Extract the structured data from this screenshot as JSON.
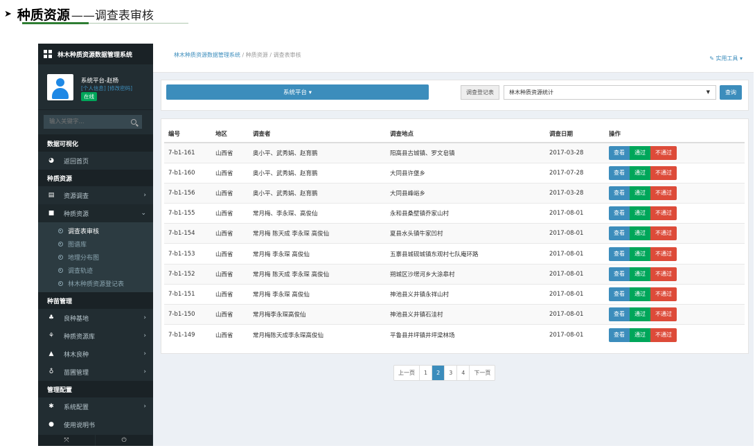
{
  "doc": {
    "title": "种质资源",
    "subtitle": "——调查表审核"
  },
  "app": {
    "system_name": "林木种质资源数据管理系统",
    "user": {
      "name": "系统平台-赵杨",
      "links": "[个人信息] [修改密码]",
      "status": "在线"
    },
    "search_placeholder": "输入关键字...",
    "sidebar": {
      "sections": [
        {
          "header": "数据可视化",
          "items": [
            {
              "label": "返回首页",
              "icon": "dashboard-icon",
              "glyph": "◕"
            }
          ]
        },
        {
          "header": "种质资源",
          "items": [
            {
              "label": "资源调查",
              "icon": "table-icon",
              "glyph": "▤",
              "chevron": "›"
            },
            {
              "label": "种质资源",
              "icon": "book-icon",
              "glyph": "■",
              "chevron": "⌄",
              "open": true
            }
          ]
        },
        {
          "header": "种苗管理",
          "items": [
            {
              "label": "良种基地",
              "icon": "tree-icon",
              "glyph": "♣",
              "chevron": "›"
            },
            {
              "label": "种质资源库",
              "icon": "leaf-icon",
              "glyph": "⚘",
              "chevron": "›"
            },
            {
              "label": "林木良种",
              "icon": "pine-icon",
              "glyph": "▲",
              "chevron": "›"
            },
            {
              "label": "苗圃管理",
              "icon": "seedling-icon",
              "glyph": "♁",
              "chevron": "›"
            }
          ]
        },
        {
          "header": "管理配置",
          "items": [
            {
              "label": "系统配置",
              "icon": "gear-icon",
              "glyph": "✱",
              "chevron": "›"
            },
            {
              "label": "使用说明书",
              "icon": "help-icon",
              "glyph": "●",
              "chevron": ""
            }
          ]
        }
      ],
      "submenu": [
        {
          "label": "调查表审核",
          "active": true
        },
        {
          "label": "图谱库"
        },
        {
          "label": "地理分布图"
        },
        {
          "label": "调查轨迹"
        },
        {
          "label": "林木种质资源登记表"
        }
      ],
      "footer": [
        {
          "icon": "expand-icon",
          "glyph": "⤧"
        },
        {
          "icon": "power-icon",
          "glyph": "⏻"
        }
      ]
    },
    "breadcrumb": [
      "林木种质资源数据管理系统",
      "种质资源",
      "调查表审核"
    ],
    "tools_label": "✎ 实用工具 ▾",
    "platform_button": "系统平台 ▾",
    "register_label": "调查登记表",
    "register_value": "林木种质资源统计",
    "query_button": "查询",
    "table": {
      "headers": [
        "编号",
        "地区",
        "调查者",
        "调查地点",
        "调查日期",
        "操作"
      ],
      "rows": [
        [
          "7-b1-161",
          "山西省",
          "奥小平、武秀娟、赵育鹏",
          "阳高县古城镇、罗文皂镇",
          "2017-03-28"
        ],
        [
          "7-b1-160",
          "山西省",
          "奥小平、武秀娟、赵育鹏",
          "大同县许堡乡",
          "2017-07-28"
        ],
        [
          "7-b1-156",
          "山西省",
          "奥小平、武秀娟、赵育鹏",
          "大同县峰峪乡",
          "2017-03-28"
        ],
        [
          "7-b1-155",
          "山西省",
          "常月梅、李永琛、高俊仙",
          "永和县桑壁镇乔家山村",
          "2017-08-01"
        ],
        [
          "7-b1-154",
          "山西省",
          "常月梅 陈天成 李永琛 高俊仙",
          "夏县水头镇牛家凹村",
          "2017-08-01"
        ],
        [
          "7-b1-153",
          "山西省",
          "常月梅 李永琛 高俊仙",
          "五寨县城砚城镇东观村七队庵环路",
          "2017-08-01"
        ],
        [
          "7-b1-152",
          "山西省",
          "常月梅 陈天成 李永琛 高俊仙",
          "朔城区沙塄河乡大涂皋村",
          "2017-08-01"
        ],
        [
          "7-b1-151",
          "山西省",
          "常月梅 李永琛 高俊仙",
          "神池县义井镇永祥山村",
          "2017-08-01"
        ],
        [
          "7-b1-150",
          "山西省",
          "常月梅李永琛高俊仙",
          "神池县义井镇石洼村",
          "2017-08-01"
        ],
        [
          "7-b1-149",
          "山西省",
          "常月梅陈天成李永琛高俊仙",
          "平鲁县井坪镇井坪梁林场",
          "2017-08-01"
        ]
      ],
      "actions": {
        "view": "查看",
        "pass": "通过",
        "fail": "不通过"
      }
    },
    "pagination": {
      "prev": "上一页",
      "pages": [
        "1",
        "2",
        "3",
        "4"
      ],
      "current": "2",
      "next": "下一页"
    }
  }
}
